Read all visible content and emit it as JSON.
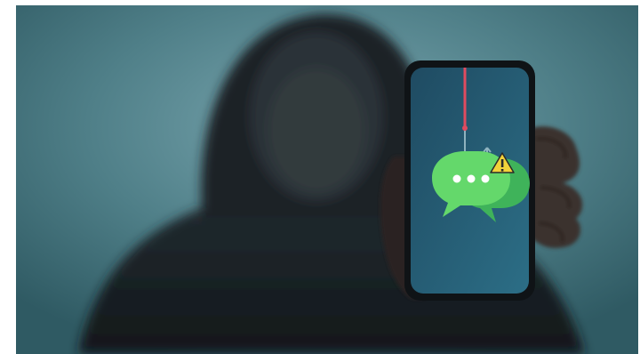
{
  "image": {
    "subject": "hooded-figure-holding-smartphone",
    "icons": [
      "chat-bubbles-icon",
      "fishing-hook-icon",
      "warning-icon"
    ],
    "colors": {
      "background_teal": "#4f7f88",
      "background_dark": "#2f5a63",
      "hoodie": "#1b2226",
      "phone_screen": "#2a5f78",
      "chat_green": "#64d86b",
      "chat_green_dark": "#3fb35a",
      "warning_yellow": "#f2d23a",
      "fishing_line": "#e04b5f"
    }
  }
}
